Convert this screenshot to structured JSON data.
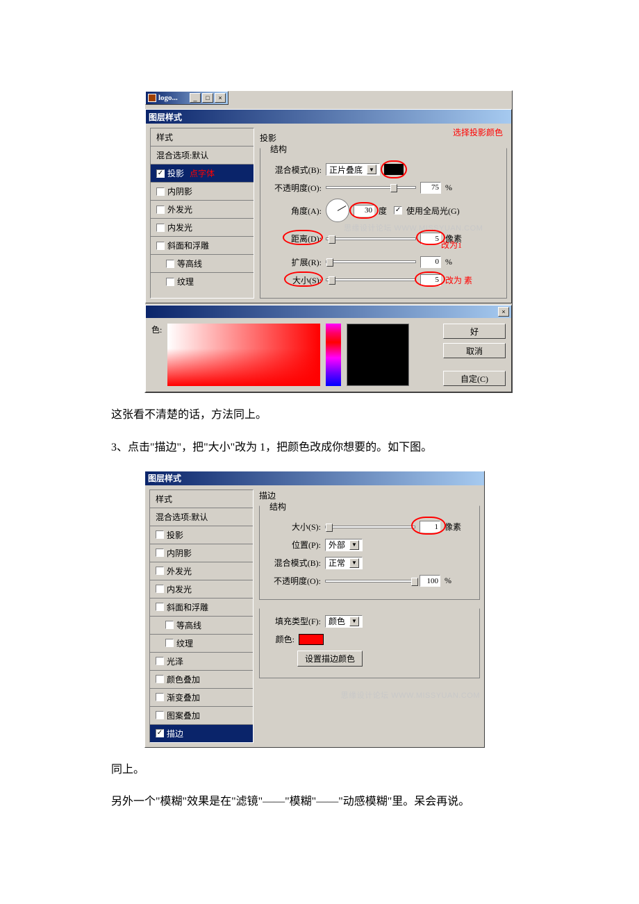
{
  "article": {
    "para1": "这张看不清楚的话，方法同上。",
    "para2": "3、点击\"描边\"，把\"大小\"改为 1，把颜色改成你想要的。如下图。",
    "para3": "同上。",
    "para4": "另外一个\"模糊\"效果是在\"滤镜\"——\"模糊\"——\"动感模糊\"里。呆会再说。"
  },
  "fig1": {
    "doc_title": "logo...",
    "dlg_title": "图层样式",
    "styles_hdr": "样式",
    "styles": [
      "混合选项:默认",
      "投影",
      "内阴影",
      "外发光",
      "内发光",
      "斜面和浮雕",
      "等高线",
      "纹理"
    ],
    "selected_index": 1,
    "anno_sel": "点字体",
    "group_outer": "投影",
    "group_inner": "结构",
    "anno_color": "选择投影颜色",
    "blend_label": "混合模式(B):",
    "blend_value": "正片叠底",
    "opacity_label": "不透明度(O):",
    "opacity_value": "75",
    "opacity_unit": "%",
    "angle_label": "角度(A):",
    "angle_value": "30",
    "angle_unit": "度",
    "global_light": "使用全局光(G)",
    "distance_label": "距离(D):",
    "distance_value": "5",
    "distance_unit": "像素",
    "distance_anno": "改为1",
    "spread_label": "扩展(R):",
    "spread_value": "0",
    "spread_unit": "%",
    "size_label": "大小(S):",
    "size_value": "5",
    "size_unit_anno": "改为 素",
    "watermark": "思缘设计论坛  WWW.MISSYUAN.COM",
    "cp_label": "色:",
    "cp_ok": "好",
    "cp_cancel": "取消",
    "cp_custom": "自定(C)"
  },
  "fig2": {
    "dlg_title": "图层样式",
    "styles_hdr": "样式",
    "styles": [
      "混合选项:默认",
      "投影",
      "内阴影",
      "外发光",
      "内发光",
      "斜面和浮雕",
      "等高线",
      "纹理",
      "光泽",
      "颜色叠加",
      "渐变叠加",
      "图案叠加",
      "描边"
    ],
    "selected_index": 12,
    "group_outer": "描边",
    "group_inner": "结构",
    "size_label": "大小(S):",
    "size_value": "1",
    "size_unit": "像素",
    "pos_label": "位置(P):",
    "pos_value": "外部",
    "blend_label": "混合模式(B):",
    "blend_value": "正常",
    "opacity_label": "不透明度(O):",
    "opacity_value": "100",
    "opacity_unit": "%",
    "filltype_label": "填充类型(F):",
    "filltype_value": "颜色",
    "color_label": "颜色:",
    "color_btn": "设置描边颜色",
    "watermark": "思缘设计论坛  WWW.MISSYUAN.COM"
  }
}
